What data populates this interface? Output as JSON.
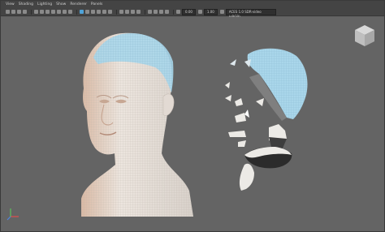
{
  "menu": {
    "items": [
      {
        "label": "View"
      },
      {
        "label": "Shading"
      },
      {
        "label": "Lighting"
      },
      {
        "label": "Show"
      },
      {
        "label": "Renderer"
      },
      {
        "label": "Panels"
      }
    ]
  },
  "toolbar": {
    "field_1": "0.00",
    "field_2": "1.00",
    "colorspace_label": "ACES 1.0 SDR-video (sRGB)"
  },
  "viewcube": {
    "label": ""
  },
  "colors": {
    "background": "#646464",
    "skin": "#e9e1d9",
    "hair_cap": "#a9d6ea",
    "accent_icon": "#4fa3d8"
  }
}
